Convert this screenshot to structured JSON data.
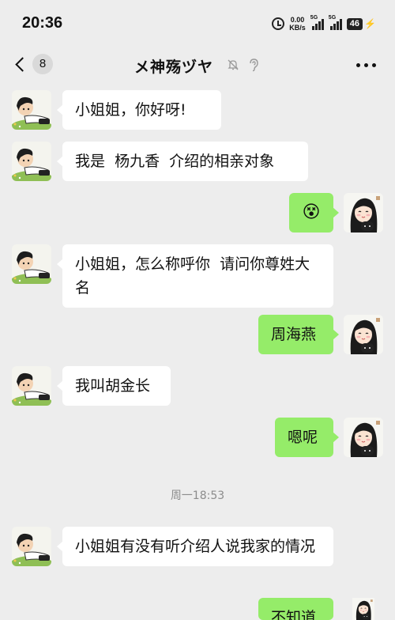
{
  "status_bar": {
    "time": "20:36",
    "speed_value": "0.00",
    "speed_unit": "KB/s",
    "signal1_label": "5G",
    "signal2_label": "5G",
    "battery": "46"
  },
  "header": {
    "unread_count": "8",
    "title": "メ神殇ヅヤ",
    "icons": [
      "back-chevron-icon",
      "bell-muted-icon",
      "ear-icon",
      "more-icon"
    ]
  },
  "messages": [
    {
      "side": "left",
      "text": "小姐姐，你好呀!"
    },
    {
      "side": "left",
      "text": "我是  杨九香  介绍的相亲对象"
    },
    {
      "side": "right",
      "emoji": "😵"
    },
    {
      "side": "left",
      "text": "小姐姐，怎么称呼你  请问你尊姓大名"
    },
    {
      "side": "right",
      "text": "周海燕"
    },
    {
      "side": "left",
      "text": "我叫胡金长"
    },
    {
      "side": "right",
      "text": "嗯呢"
    },
    {
      "side": "left",
      "text": "小姐姐有没有听介绍人说我家的情况"
    },
    {
      "side": "right",
      "text": "不知道"
    }
  ],
  "timestamp": "周一18:53",
  "colors": {
    "background": "#ededed",
    "sent_bubble": "#95ec69",
    "received_bubble": "#ffffff"
  }
}
